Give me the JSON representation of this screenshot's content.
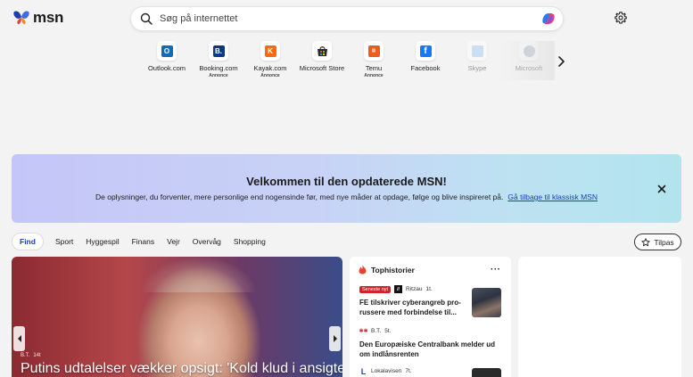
{
  "brand": {
    "logo_text": "msn"
  },
  "search": {
    "placeholder": "Søg på internettet"
  },
  "quick_links": [
    {
      "label": "Outlook.com",
      "annotation": "",
      "color": "#0f6cbd",
      "glyph": "O"
    },
    {
      "label": "Booking.com",
      "annotation": "Annonce",
      "color": "#0c3a82",
      "glyph": "B."
    },
    {
      "label": "Kayak.com",
      "annotation": "Annonce",
      "color": "#ff690f",
      "glyph": "K"
    },
    {
      "label": "Microsoft Store",
      "annotation": "",
      "color": "#2b2b2b",
      "glyph": ""
    },
    {
      "label": "Temu",
      "annotation": "Annonce",
      "color": "#f05a1a",
      "glyph": ""
    },
    {
      "label": "Facebook",
      "annotation": "",
      "color": "#1877f2",
      "glyph": "f"
    },
    {
      "label": "Skype",
      "annotation": "",
      "color": "#9fc8ee",
      "glyph": ""
    },
    {
      "label": "Microsoft",
      "annotation": "",
      "color": "#9aa7bd",
      "glyph": ""
    }
  ],
  "banner": {
    "title": "Velkommen til den opdaterede MSN!",
    "description": "De oplysninger, du forventer, mere personlige end nogensinde før, med nye måder at opdage, følge og blive inspireret på.",
    "link": "Gå tilbage til klassisk MSN"
  },
  "nav": {
    "items": [
      "Find",
      "Sport",
      "Hyggespil",
      "Finans",
      "Vejr",
      "Overvåg",
      "Shopping"
    ],
    "active": "Find",
    "customize": "Tilpas"
  },
  "hero": {
    "source": "B.T.",
    "time": "14t",
    "headline": "Putins udtalelser vækker opsigt: 'Kold klud i ansigtet"
  },
  "top_stories": {
    "title": "Tophistorier",
    "stories": [
      {
        "badge": "Seneste nyt",
        "source": "Ritzau",
        "time": "1t.",
        "headline": "FE tilskriver cyberangreb pro-russere med forbindelse til..."
      },
      {
        "badge": "",
        "source": "B.T.",
        "time": "5t.",
        "headline": "Den Europæiske Centralbank melder ud om indlånsrenten"
      },
      {
        "badge": "",
        "source": "Lokalavisen",
        "time": "7t.",
        "headline": ""
      }
    ]
  },
  "colors": {
    "accent": "#1a3fb6",
    "breaking": "#d3232a"
  }
}
